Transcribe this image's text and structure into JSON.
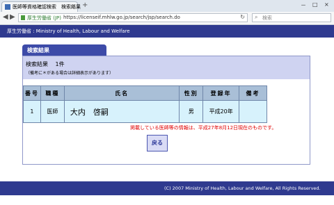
{
  "browser": {
    "tab_title": "医師等資格確認検索　検索結果",
    "tab_close": "×",
    "new_tab": "+",
    "window_controls": [
      "－",
      "□",
      "×"
    ],
    "url_owner": "厚生労働省 (JP)",
    "url": "https://licenseif.mhlw.go.jp/search/jsp/search.do",
    "search_placeholder": "検索"
  },
  "site": {
    "header": "厚生労働省 : Ministry of Health, Labour and Welfare",
    "footer": "(C) 2007 Ministry of Health, Labour and Welfare, All Rights Reserved."
  },
  "results": {
    "panel_title": "検索結果",
    "count_text": "検索結果　 1件",
    "note": "（備考に＊がある場合は詳細表示があります）",
    "columns": [
      "番号",
      "職種",
      "氏名",
      "性別",
      "登録年",
      "備考"
    ],
    "rows": [
      {
        "no": "1",
        "profession": "医師",
        "name": "大内　啓嗣",
        "sex": "男",
        "year": "平成20年",
        "remarks": ""
      }
    ],
    "notice": "掲載している医師等の情報は、平成27年8月12日現在のものです。",
    "back_label": "戻る"
  }
}
